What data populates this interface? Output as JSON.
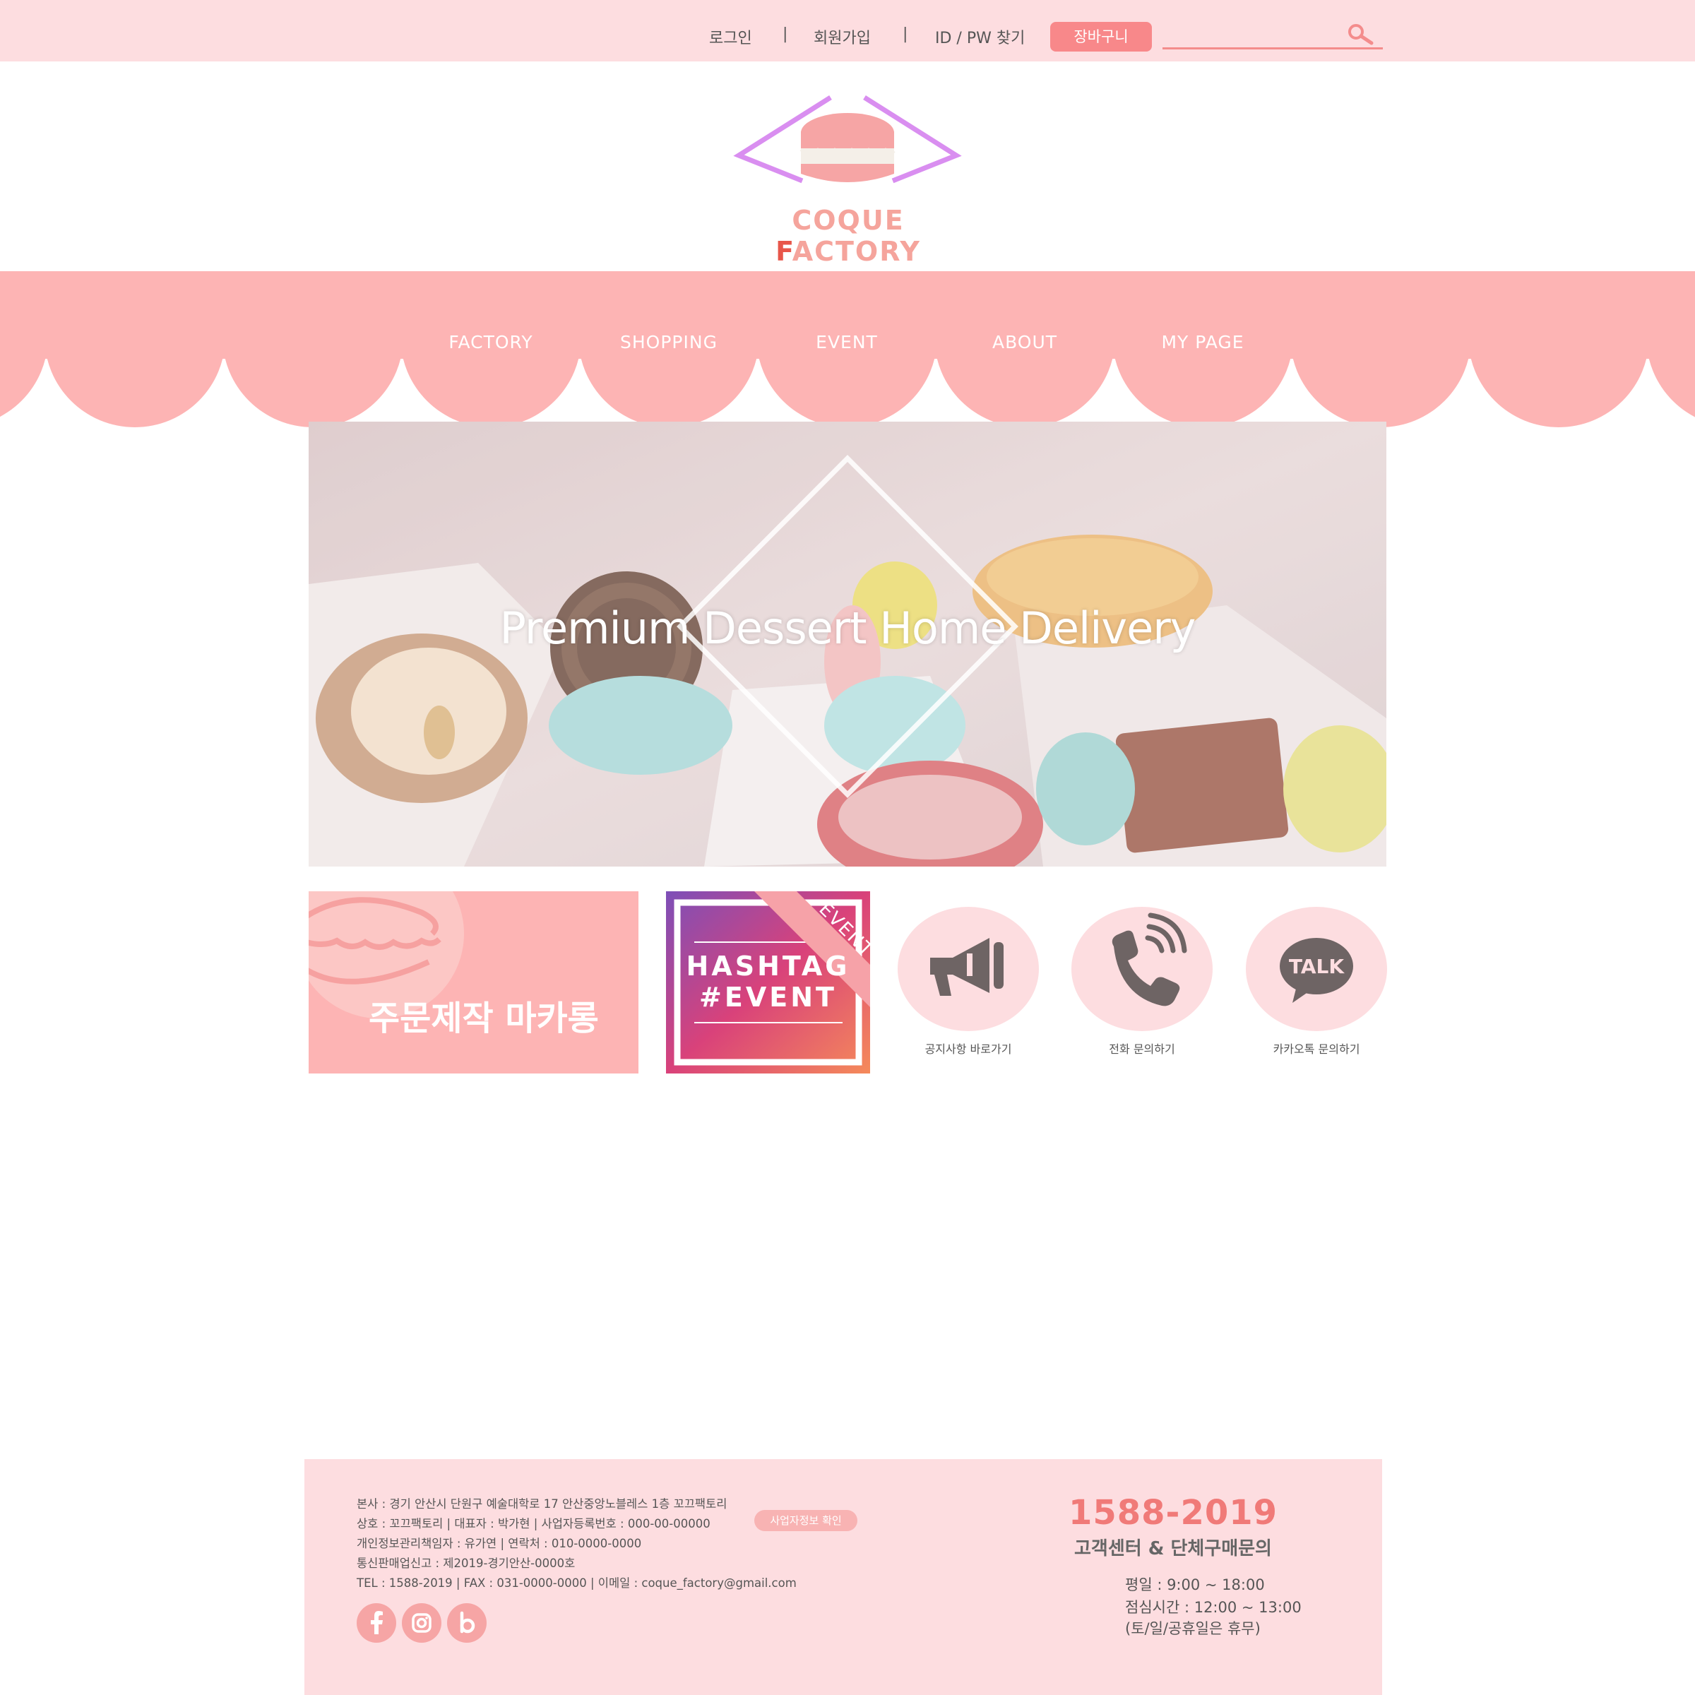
{
  "colors": {
    "brand_pink": "#fdb4b4",
    "light_pink": "#fddde0",
    "accent_coral": "#f8888a",
    "logo_purple": "#d98ef0"
  },
  "topbar": {
    "login": "로그인",
    "signup": "회원가입",
    "find_id_pw": "ID / PW 찾기",
    "separator": "|",
    "cart": "장바구니",
    "search_placeholder": "",
    "search_icon": "search-icon"
  },
  "logo": {
    "text_part1": "COQUE ",
    "text_accent": "F",
    "text_part2": "ACTORY"
  },
  "nav": {
    "items": [
      {
        "label": "FACTORY"
      },
      {
        "label": "SHOPPING"
      },
      {
        "label": "EVENT"
      },
      {
        "label": "ABOUT"
      },
      {
        "label": "MY PAGE"
      }
    ]
  },
  "hero": {
    "title": "Premium Dessert Home Delivery"
  },
  "promos": {
    "macaron": "주문제작 마카롱",
    "hashtag_line1": "HASHTAG",
    "hashtag_line2": "#EVENT",
    "event_ribbon": "EVENT"
  },
  "quick_links": [
    {
      "label": "공지사항 바로가기",
      "icon": "megaphone-icon"
    },
    {
      "label": "전화 문의하기",
      "icon": "phone-icon"
    },
    {
      "label": "카카오톡 문의하기",
      "icon": "talk-icon",
      "icon_text": "TALK"
    }
  ],
  "footer": {
    "address": "본사 : 경기 안산시 단원구 예술대학로 17 안산중앙노블레스 1층 꼬끄팩토리",
    "company": "상호 : 꼬끄팩토리  |  대표자 : 박가현  |  사업자등록번호 : 000-00-00000",
    "business_check": "사업자정보 확인",
    "privacy": "개인정보관리책임자 : 유가연  |  연락처 : 010-0000-0000",
    "ecommerce": "통신판매업신고 : 제2019-경기안산-0000호",
    "contact": "TEL : 1588-2019  |  FAX : 031-0000-0000  |  이메일 : coque_factory@gmail.com",
    "social": [
      "facebook-icon",
      "instagram-icon",
      "blog-icon"
    ],
    "cs_phone": "1588-2019",
    "cs_title": "고객센터 & 단체구매문의",
    "hours_weekday": "평일 : 9:00 ~ 18:00",
    "hours_lunch": "점심시간 : 12:00 ~ 13:00",
    "hours_closed": "(토/일/공휴일은 휴무)"
  }
}
